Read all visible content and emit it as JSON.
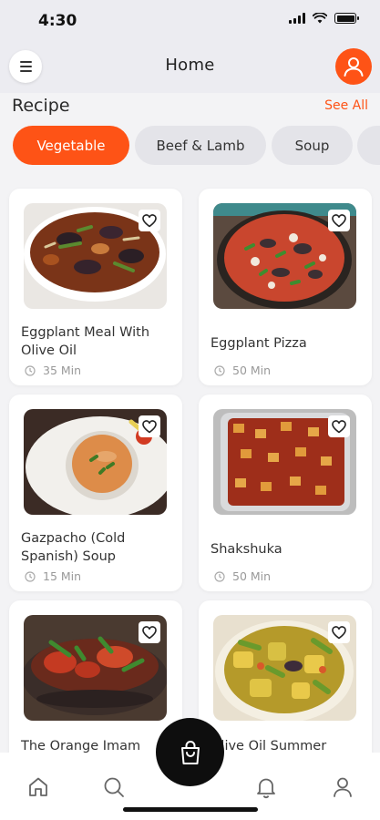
{
  "status_bar": {
    "time": "4:30"
  },
  "header": {
    "title": "Home"
  },
  "section": {
    "title": "Recipe",
    "see_all": "See All"
  },
  "categories": [
    "Vegetable",
    "Beef & Lamb",
    "Soup"
  ],
  "recipes": [
    {
      "title": "Eggplant Meal With Olive Oil",
      "time": "35 Min"
    },
    {
      "title": "Eggplant Pizza",
      "time": "50 Min"
    },
    {
      "title": "Gazpacho (Cold Spanish) Soup",
      "time": "15 Min"
    },
    {
      "title": "Shakshuka",
      "time": "50 Min"
    },
    {
      "title": "The Orange Imam",
      "time": ""
    },
    {
      "title": "Olive Oil Summer",
      "time": ""
    }
  ],
  "colors": {
    "accent": "#fe5316",
    "background": "#f3f3f5",
    "fab": "#0e0e0e"
  },
  "icons": {
    "menu": "menu-icon",
    "profile": "user-icon",
    "favorite": "heart-icon",
    "time": "clock-icon",
    "nav": [
      "home-icon",
      "search-icon",
      "bell-icon",
      "user-icon"
    ],
    "fab": "shopping-bag-icon"
  }
}
